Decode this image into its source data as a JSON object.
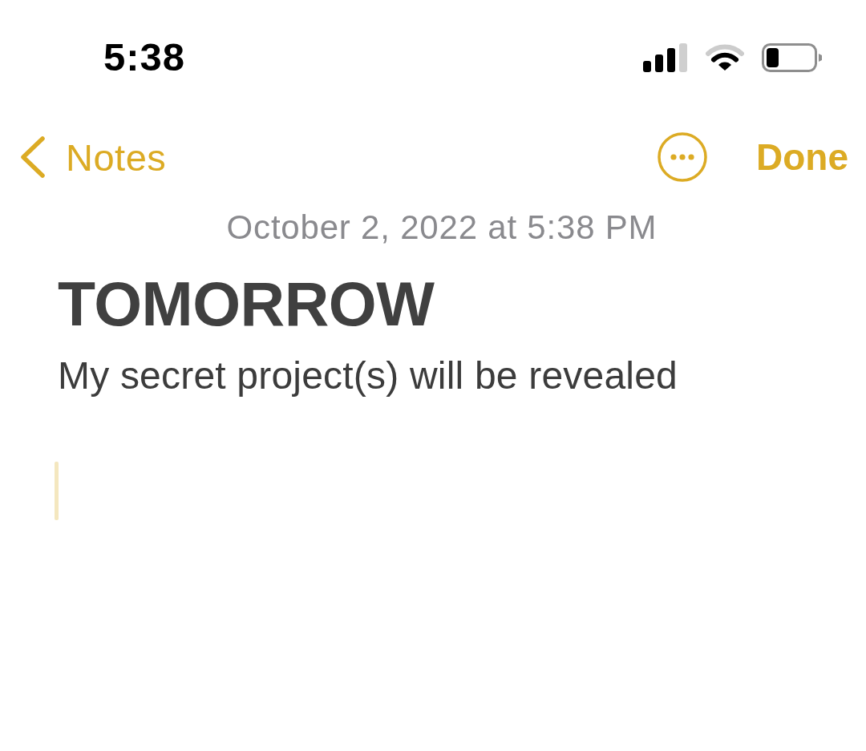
{
  "status_bar": {
    "time": "5:38"
  },
  "nav": {
    "back_label": "Notes",
    "done_label": "Done"
  },
  "note": {
    "date": "October 2, 2022 at 5:38 PM",
    "title": "TOMORROW",
    "body": "My secret project(s) will be revealed"
  }
}
